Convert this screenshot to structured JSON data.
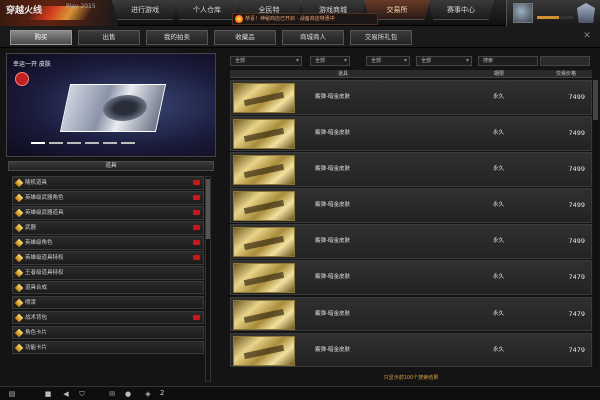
{
  "header": {
    "logo_text": "穿越火线",
    "logo_sub": "Play 2015",
    "nav_tabs": [
      "进行游戏",
      "个人仓库",
      "全民特",
      "游戏商城",
      "交易所",
      "赛事中心"
    ],
    "active_tab_index": 4,
    "alert_text": "恭喜！神秘商店已开启 · 战备商店特惠中"
  },
  "subtabs": {
    "items": [
      "购买",
      "出售",
      "我的拍卖",
      "收藏品",
      "商城商人",
      "交易所礼包"
    ],
    "active_index": 0,
    "close_label": "✕"
  },
  "banner": {
    "title": "幸运一开 皮肤",
    "badge": "hot"
  },
  "categories": {
    "header": "道具",
    "items": [
      {
        "label": "随机道具",
        "new": true
      },
      {
        "label": "英雄级武器角色",
        "new": true
      },
      {
        "label": "英雄级武器道具",
        "new": true
      },
      {
        "label": "武器",
        "new": true
      },
      {
        "label": "英雄级角色",
        "new": true
      },
      {
        "label": "英雄级道具特权",
        "new": true
      },
      {
        "label": "王者级道具特权",
        "new": false
      },
      {
        "label": "道具合成",
        "new": false
      },
      {
        "label": "喷漆",
        "new": false
      },
      {
        "label": "战术背包",
        "new": true
      },
      {
        "label": "角色卡片",
        "new": false
      },
      {
        "label": "功能卡片",
        "new": false
      }
    ]
  },
  "filters": {
    "type": "全部",
    "sub": "全部",
    "grade": "全部",
    "sort": "全部",
    "search_placeholder": "搜索"
  },
  "table": {
    "headers": {
      "item": "道具",
      "duration": "期限",
      "price": "交易价格"
    },
    "rows": [
      {
        "name": "霰弹-暗金皮肤",
        "duration": "永久",
        "price": "7499"
      },
      {
        "name": "霰弹-暗金皮肤",
        "duration": "永久",
        "price": "7499"
      },
      {
        "name": "霰弹-暗金皮肤",
        "duration": "永久",
        "price": "7499"
      },
      {
        "name": "霰弹-暗金皮肤",
        "duration": "永久",
        "price": "7499"
      },
      {
        "name": "霰弹-暗金皮肤",
        "duration": "永久",
        "price": "7499"
      },
      {
        "name": "霰弹-暗金皮肤",
        "duration": "永久",
        "price": "7479"
      },
      {
        "name": "霰弹-暗金皮肤",
        "duration": "永久",
        "price": "7479"
      },
      {
        "name": "霰弹-暗金皮肤",
        "duration": "永久",
        "price": "7479"
      }
    ]
  },
  "footer_note": "只显示前100个搜索结果",
  "bottombar": {
    "count": "2"
  },
  "colors": {
    "accent": "#d09030",
    "alert": "#c81818",
    "gold": "#e8d48a"
  }
}
